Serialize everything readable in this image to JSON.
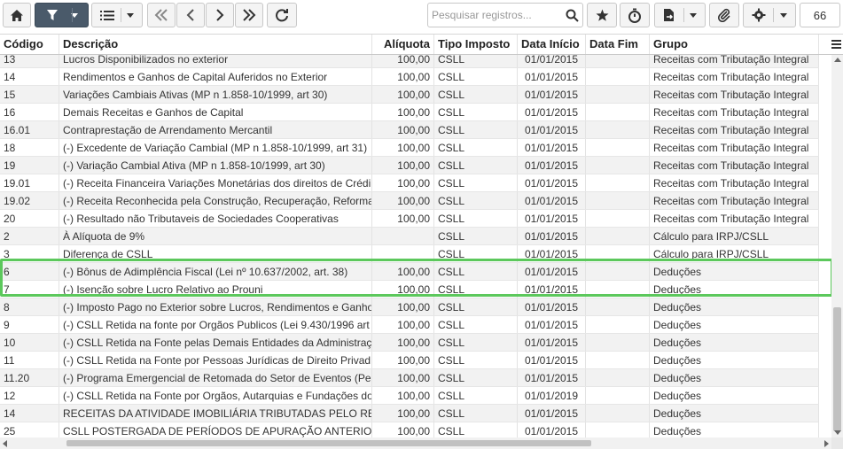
{
  "toolbar": {
    "search_placeholder": "Pesquisar registros...",
    "record_count": "66",
    "buttons": [
      {
        "name": "home-button",
        "icon": "home-icon"
      },
      {
        "name": "filter-button",
        "icon": "filter-icon"
      },
      {
        "name": "list-view-button",
        "icon": "list-icon"
      },
      {
        "name": "first-page-button",
        "icon": "double-chevron-left-icon"
      },
      {
        "name": "previous-page-button",
        "icon": "chevron-left-icon"
      },
      {
        "name": "next-page-button",
        "icon": "chevron-right-icon"
      },
      {
        "name": "last-page-button",
        "icon": "double-chevron-right-icon"
      },
      {
        "name": "refresh-button",
        "icon": "refresh-icon"
      },
      {
        "name": "favorite-button",
        "icon": "star-icon"
      },
      {
        "name": "timer-button",
        "icon": "stopwatch-icon"
      },
      {
        "name": "export-button",
        "icon": "file-export-icon"
      },
      {
        "name": "attachment-button",
        "icon": "paperclip-icon"
      },
      {
        "name": "settings-button",
        "icon": "gear-icon"
      }
    ],
    "colors": {
      "dark_button": "#4a5a6a",
      "highlight": "#5cc85c",
      "row_alt": "#f2f2f2"
    }
  },
  "grid": {
    "columns": [
      "Código",
      "Descrição",
      "Alíquota",
      "Tipo Imposto",
      "Data Início",
      "Data Fim",
      "Grupo"
    ],
    "rows": [
      {
        "codigo": "13",
        "descricao": "Lucros Disponibilizados no exterior",
        "aliquota": "100,00",
        "tipo": "CSLL",
        "inicio": "01/01/2015",
        "fim": "",
        "grupo": "Receitas com Tributação Integral"
      },
      {
        "codigo": "14",
        "descricao": "Rendimentos e Ganhos de Capital Auferidos no Exterior",
        "aliquota": "100,00",
        "tipo": "CSLL",
        "inicio": "01/01/2015",
        "fim": "",
        "grupo": "Receitas com Tributação Integral"
      },
      {
        "codigo": "15",
        "descricao": "Variações Cambiais Ativas (MP n 1.858-10/1999, art 30)",
        "aliquota": "100,00",
        "tipo": "CSLL",
        "inicio": "01/01/2015",
        "fim": "",
        "grupo": "Receitas com Tributação Integral"
      },
      {
        "codigo": "16",
        "descricao": "Demais Receitas e Ganhos de Capital",
        "aliquota": "100,00",
        "tipo": "CSLL",
        "inicio": "01/01/2015",
        "fim": "",
        "grupo": "Receitas com Tributação Integral"
      },
      {
        "codigo": "16.01",
        "descricao": "Contraprestação de Arrendamento Mercantil",
        "aliquota": "100,00",
        "tipo": "CSLL",
        "inicio": "01/01/2015",
        "fim": "",
        "grupo": "Receitas com Tributação Integral"
      },
      {
        "codigo": "18",
        "descricao": "(-) Excedente de Variação Cambial (MP n 1.858-10/1999, art 31)",
        "aliquota": "100,00",
        "tipo": "CSLL",
        "inicio": "01/01/2015",
        "fim": "",
        "grupo": "Receitas com Tributação Integral"
      },
      {
        "codigo": "19",
        "descricao": "(-) Variação Cambial Ativa (MP n 1.858-10/1999, art 30)",
        "aliquota": "100,00",
        "tipo": "CSLL",
        "inicio": "01/01/2015",
        "fim": "",
        "grupo": "Receitas com Tributação Integral"
      },
      {
        "codigo": "19.01",
        "descricao": "(-) Receita Financeira Variações Monetárias dos direitos de Crédi",
        "aliquota": "100,00",
        "tipo": "CSLL",
        "inicio": "01/01/2015",
        "fim": "",
        "grupo": "Receitas com Tributação Integral"
      },
      {
        "codigo": "19.02",
        "descricao": "(-) Receita Reconhecida pela Construção, Recuperação, Reforma",
        "aliquota": "100,00",
        "tipo": "CSLL",
        "inicio": "01/01/2015",
        "fim": "",
        "grupo": "Receitas com Tributação Integral"
      },
      {
        "codigo": "20",
        "descricao": "(-) Resultado não Tributaveis de Sociedades Cooperativas",
        "aliquota": "100,00",
        "tipo": "CSLL",
        "inicio": "01/01/2015",
        "fim": "",
        "grupo": "Receitas com Tributação Integral"
      },
      {
        "codigo": "2",
        "descricao": "À Alíquota de 9%",
        "aliquota": "",
        "tipo": "CSLL",
        "inicio": "01/01/2015",
        "fim": "",
        "grupo": "Cálculo para IRPJ/CSLL"
      },
      {
        "codigo": "3",
        "descricao": "Diferença de CSLL",
        "aliquota": "",
        "tipo": "CSLL",
        "inicio": "01/01/2015",
        "fim": "",
        "grupo": "Cálculo para IRPJ/CSLL"
      },
      {
        "codigo": "6",
        "descricao": "(-) Bônus de Adimplência Fiscal (Lei nº 10.637/2002, art. 38)",
        "aliquota": "100,00",
        "tipo": "CSLL",
        "inicio": "01/01/2015",
        "fim": "",
        "grupo": "Deduções"
      },
      {
        "codigo": "7",
        "descricao": "(-) Isenção sobre Lucro Relativo ao Prouni",
        "aliquota": "100,00",
        "tipo": "CSLL",
        "inicio": "01/01/2015",
        "fim": "",
        "grupo": "Deduções"
      },
      {
        "codigo": "8",
        "descricao": "(-) Imposto Pago no Exterior sobre Lucros, Rendimentos e Ganho",
        "aliquota": "100,00",
        "tipo": "CSLL",
        "inicio": "01/01/2015",
        "fim": "",
        "grupo": "Deduções"
      },
      {
        "codigo": "9",
        "descricao": "(-) CSLL Retida na fonte por Orgãos Publicos (Lei 9.430/1996 art",
        "aliquota": "100,00",
        "tipo": "CSLL",
        "inicio": "01/01/2015",
        "fim": "",
        "grupo": "Deduções"
      },
      {
        "codigo": "10",
        "descricao": "(-) CSLL Retida na Fonte pelas Demais Entidades da Administraç",
        "aliquota": "100,00",
        "tipo": "CSLL",
        "inicio": "01/01/2015",
        "fim": "",
        "grupo": "Deduções"
      },
      {
        "codigo": "11",
        "descricao": "(-) CSLL Retida na Fonte por Pessoas Jurídicas de Direito Privad",
        "aliquota": "100,00",
        "tipo": "CSLL",
        "inicio": "01/01/2015",
        "fim": "",
        "grupo": "Deduções"
      },
      {
        "codigo": "11.20",
        "descricao": "(-) Programa Emergencial de Retomada do Setor de Eventos (Pe",
        "aliquota": "100,00",
        "tipo": "CSLL",
        "inicio": "01/01/2015",
        "fim": "",
        "grupo": "Deduções"
      },
      {
        "codigo": "12",
        "descricao": "(-) CSLL Retida na Fonte por Orgãos, Autarquias e Fundações do",
        "aliquota": "100,00",
        "tipo": "CSLL",
        "inicio": "01/01/2019",
        "fim": "",
        "grupo": "Deduções"
      },
      {
        "codigo": "14",
        "descricao": "RECEITAS DA ATIVIDADE IMOBILIÁRIA TRIBUTADAS PELO RE",
        "aliquota": "100,00",
        "tipo": "CSLL",
        "inicio": "01/01/2015",
        "fim": "",
        "grupo": "Deduções"
      },
      {
        "codigo": "25",
        "descricao": "CSLL POSTERGADA DE PERÍODOS DE APURAÇÃO ANTERIO",
        "aliquota": "100,00",
        "tipo": "CSLL",
        "inicio": "01/01/2015",
        "fim": "",
        "grupo": "Deduções"
      }
    ]
  }
}
